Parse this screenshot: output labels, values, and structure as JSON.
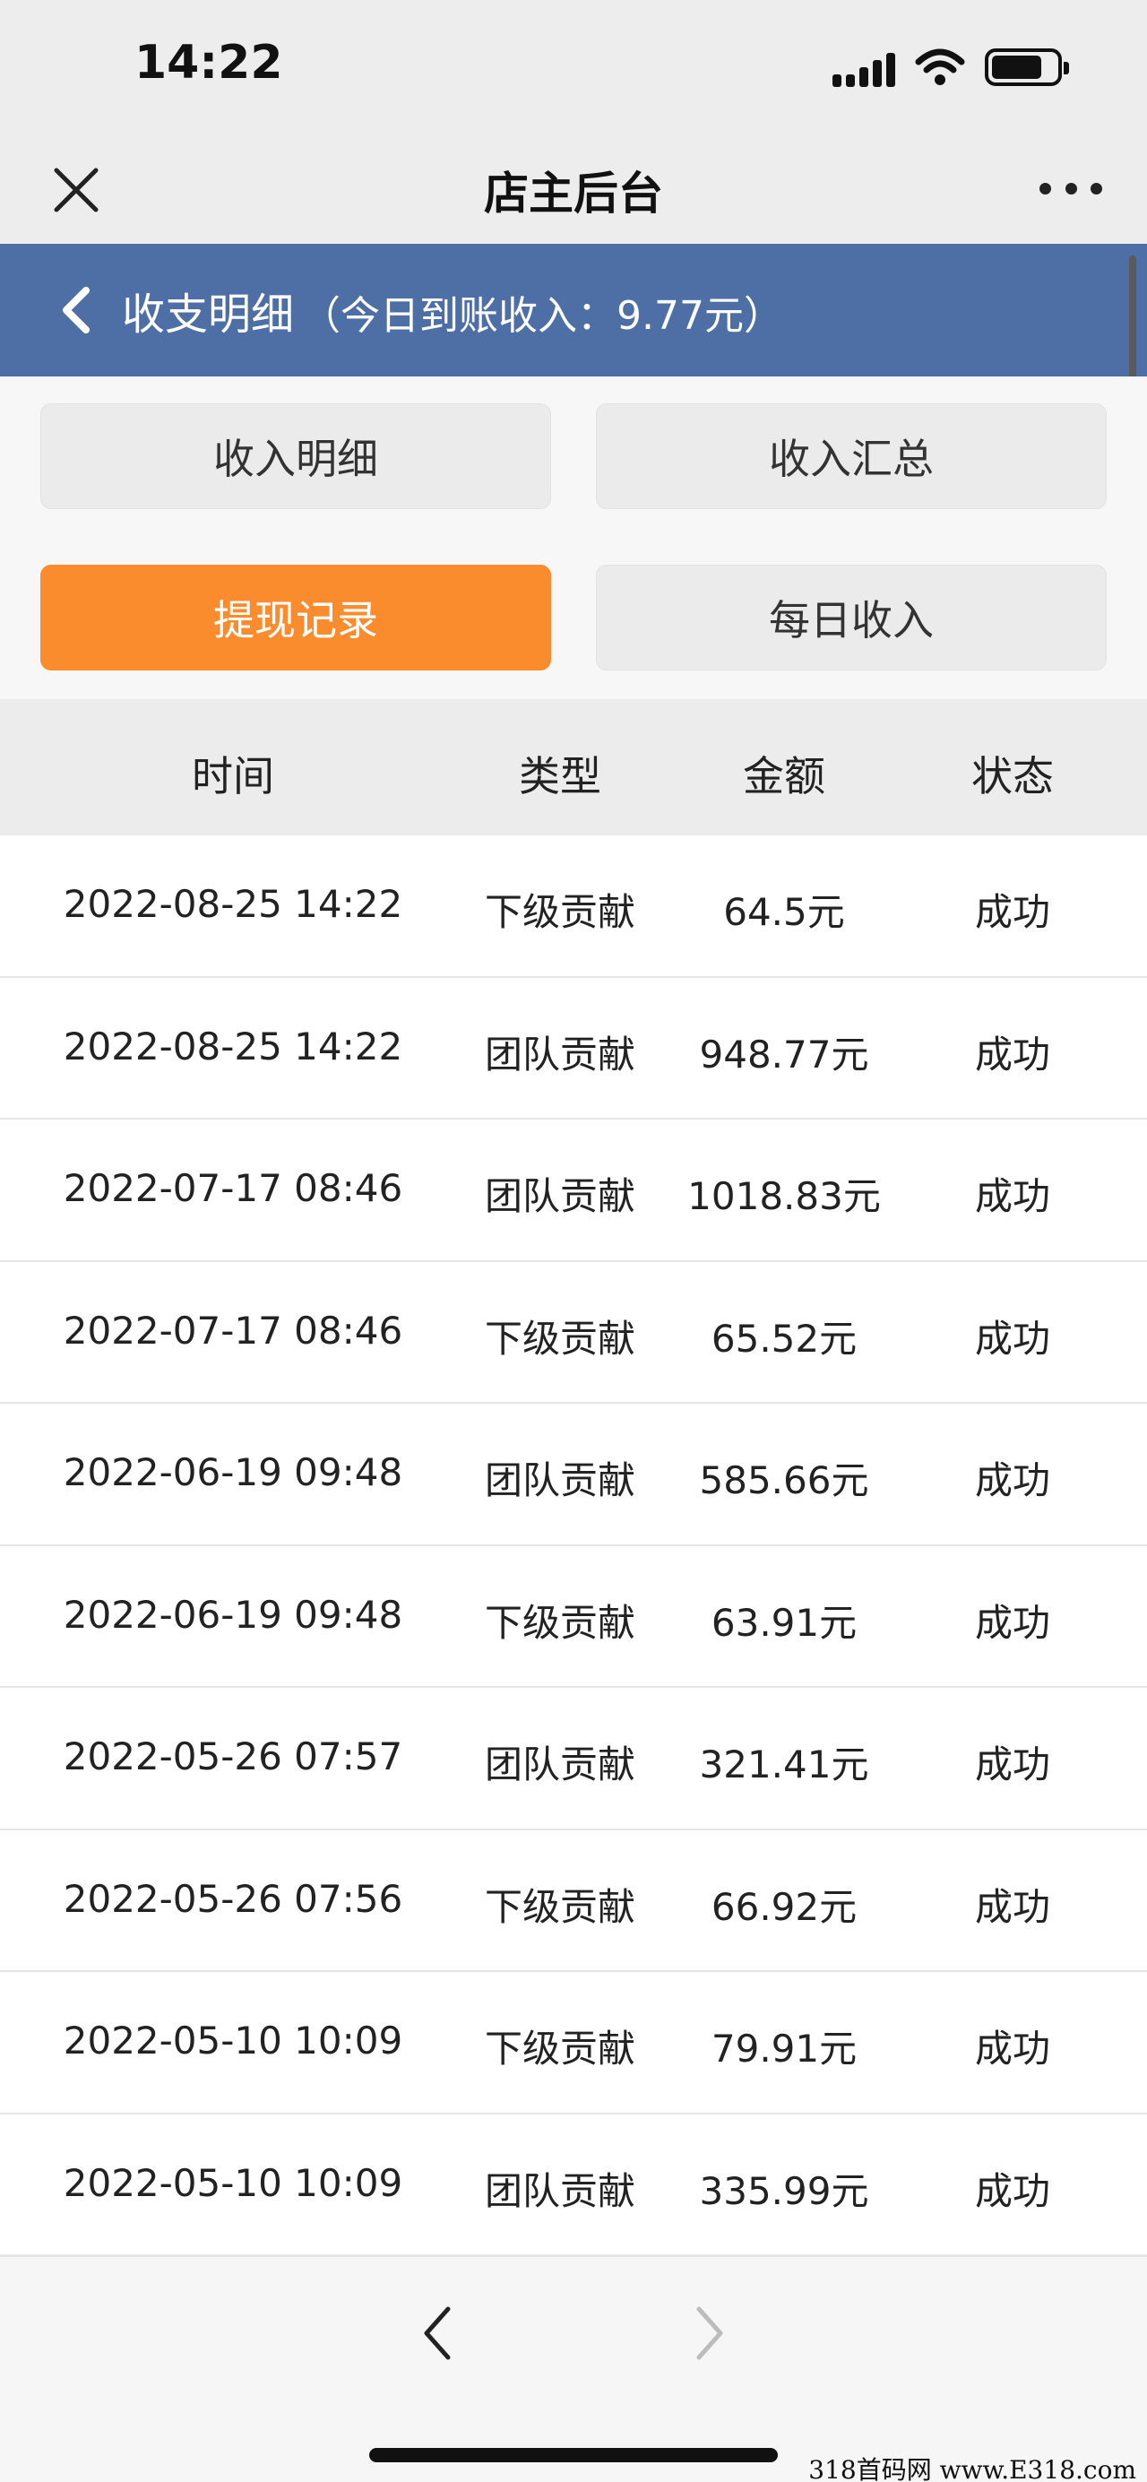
{
  "status_bar": {
    "time": "14:22"
  },
  "nav": {
    "title": "店主后台"
  },
  "header": {
    "title": "收支明细",
    "subtitle": "（今日到账收入：9.77元）"
  },
  "tabs": [
    {
      "label": "收入明细",
      "active": false
    },
    {
      "label": "收入汇总",
      "active": false
    },
    {
      "label": "提现记录",
      "active": true
    },
    {
      "label": "每日收入",
      "active": false
    }
  ],
  "table": {
    "headers": [
      "时间",
      "类型",
      "金额",
      "状态"
    ],
    "rows": [
      [
        "2022-08-25 14:22",
        "下级贡献",
        "64.5元",
        "成功"
      ],
      [
        "2022-08-25 14:22",
        "团队贡献",
        "948.77元",
        "成功"
      ],
      [
        "2022-07-17 08:46",
        "团队贡献",
        "1018.83元",
        "成功"
      ],
      [
        "2022-07-17 08:46",
        "下级贡献",
        "65.52元",
        "成功"
      ],
      [
        "2022-06-19 09:48",
        "团队贡献",
        "585.66元",
        "成功"
      ],
      [
        "2022-06-19 09:48",
        "下级贡献",
        "63.91元",
        "成功"
      ],
      [
        "2022-05-26 07:57",
        "团队贡献",
        "321.41元",
        "成功"
      ],
      [
        "2022-05-26 07:56",
        "下级贡献",
        "66.92元",
        "成功"
      ],
      [
        "2022-05-10 10:09",
        "下级贡献",
        "79.91元",
        "成功"
      ],
      [
        "2022-05-10 10:09",
        "团队贡献",
        "335.99元",
        "成功"
      ]
    ]
  },
  "watermark": "318首码网 www.E318.com",
  "colors": {
    "header_bg": "#4e6fa5",
    "active_tab": "#fb8c2e"
  },
  "icons": [
    "close-icon",
    "more-icon",
    "back-chevron-icon",
    "nav-back-icon",
    "nav-forward-icon",
    "signal-icon",
    "wifi-icon",
    "battery-icon"
  ]
}
